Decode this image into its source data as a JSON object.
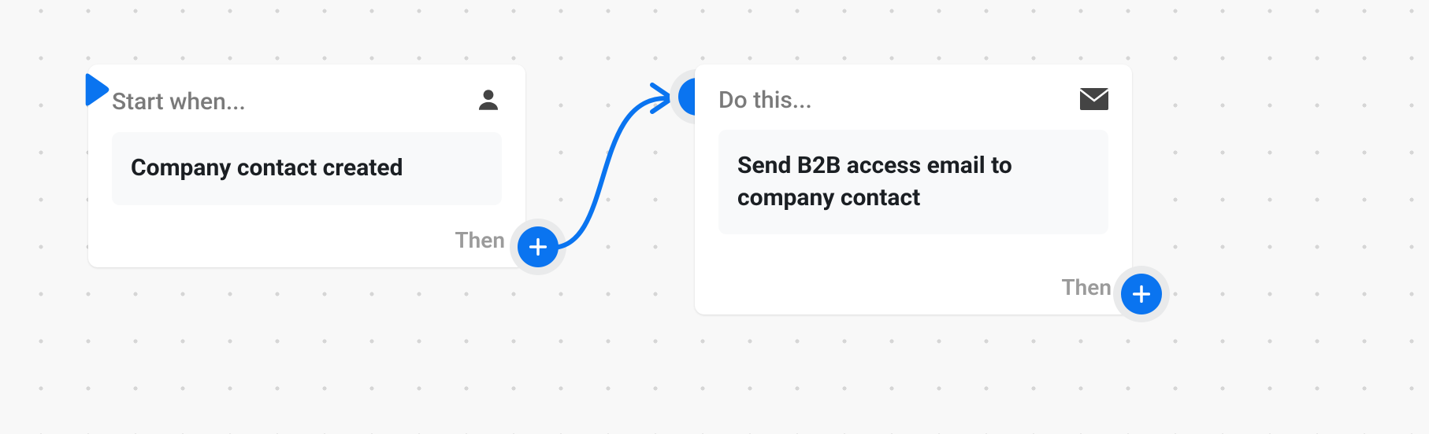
{
  "colors": {
    "accent": "#0a74f0",
    "background": "#f8f8f8",
    "card": "#ffffff",
    "muted": "#7a7a7a"
  },
  "nodes": {
    "trigger": {
      "header": "Start when...",
      "icon": "person-icon",
      "body": "Company contact created",
      "then_label": "Then"
    },
    "action": {
      "header": "Do this...",
      "icon": "envelope-icon",
      "body": "Send B2B access email to company contact",
      "then_label": "Then"
    }
  }
}
